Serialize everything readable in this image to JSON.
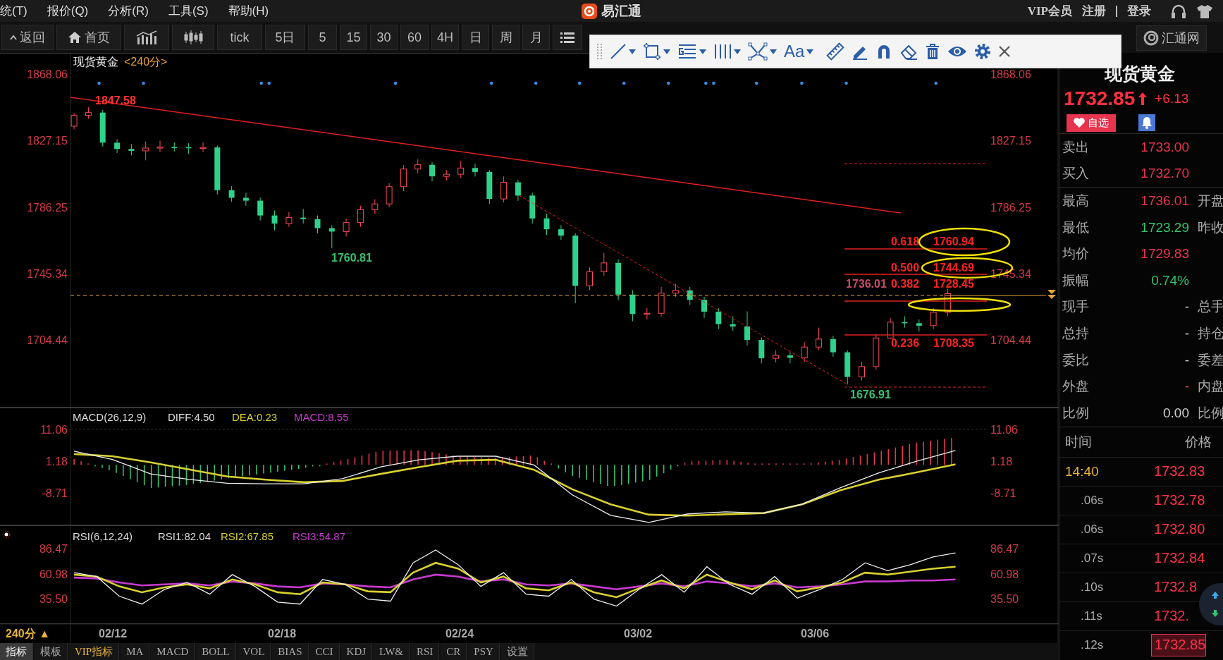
{
  "menu_bar": {
    "items": [
      "统(T)",
      "报价(Q)",
      "分析(R)",
      "工具(S)",
      "帮助(H)"
    ],
    "app_name": "易汇通",
    "vip": "VIP会员",
    "register": "注册",
    "login": "登录"
  },
  "toolbar": {
    "back": "返回",
    "home": "首页",
    "periods": [
      "tick",
      "5日",
      "5",
      "15",
      "30",
      "60",
      "4H",
      "日",
      "周",
      "月"
    ],
    "site": "汇通网"
  },
  "drawing_toolbar": {
    "text_tool": "Aa"
  },
  "price_chart": {
    "symbol": "现货黄金",
    "period": "<240分>",
    "right_labels": [
      "1868.06",
      "1827.15",
      "1786.25",
      "1745.34",
      "1704.44"
    ],
    "chart_data": {
      "type": "candlestick",
      "yticks": [
        {
          "value": 1868.06,
          "label": "1868.06"
        },
        {
          "value": 1827.15,
          "label": "1827.15"
        },
        {
          "value": 1786.25,
          "label": "1786.25"
        },
        {
          "value": 1745.34,
          "label": "1745.34"
        },
        {
          "value": 1704.44,
          "label": "1704.44"
        }
      ],
      "ylim": [
        1662.78,
        1881.08
      ],
      "categories": [
        null,
        null,
        null,
        null,
        null,
        null,
        null,
        null,
        null,
        null,
        null,
        null,
        null,
        null,
        null,
        null,
        null,
        null,
        null,
        null,
        null,
        null,
        null,
        null,
        null,
        null,
        null,
        null,
        null,
        null,
        null,
        null,
        null,
        null,
        null,
        null,
        null,
        null,
        null,
        null,
        null,
        null,
        null,
        null,
        null,
        null,
        null,
        null,
        null,
        null,
        null,
        null,
        null,
        null,
        null,
        null,
        null,
        null,
        null,
        null,
        null,
        null
      ],
      "ohlc": [
        [
          1836.0,
          1844.0,
          1834.0,
          1842.6
        ],
        [
          1842.6,
          1847.58,
          1840.5,
          1844.3
        ],
        [
          1844.3,
          1846.0,
          1823.5,
          1825.8
        ],
        [
          1825.8,
          1828.0,
          1819.5,
          1822.0
        ],
        [
          1822.0,
          1825.0,
          1818.0,
          1820.8
        ],
        [
          1820.8,
          1826.5,
          1815.0,
          1822.5
        ],
        [
          1822.5,
          1827.0,
          1820.0,
          1823.2
        ],
        [
          1823.2,
          1826.0,
          1820.5,
          1823.0
        ],
        [
          1823.0,
          1825.5,
          1819.0,
          1822.6
        ],
        [
          1822.6,
          1826.0,
          1820.0,
          1822.9
        ],
        [
          1822.9,
          1824.0,
          1794.0,
          1796.6
        ],
        [
          1796.6,
          1799.0,
          1789.5,
          1791.9
        ],
        [
          1791.9,
          1795.0,
          1787.0,
          1790.1
        ],
        [
          1790.1,
          1792.0,
          1778.0,
          1781.0
        ],
        [
          1781.0,
          1784.0,
          1772.0,
          1776.0
        ],
        [
          1776.0,
          1783.0,
          1774.0,
          1779.7
        ],
        [
          1779.7,
          1785.0,
          1776.0,
          1778.8
        ],
        [
          1778.8,
          1781.0,
          1770.0,
          1773.2
        ],
        [
          1773.2,
          1775.0,
          1760.81,
          1771.1
        ],
        [
          1771.1,
          1779.0,
          1768.0,
          1776.6
        ],
        [
          1776.6,
          1787.0,
          1774.0,
          1784.6
        ],
        [
          1784.6,
          1791.0,
          1782.0,
          1788.1
        ],
        [
          1788.1,
          1801.0,
          1786.0,
          1798.7
        ],
        [
          1798.7,
          1812.0,
          1796.0,
          1809.6
        ],
        [
          1809.6,
          1815.5,
          1807.0,
          1812.2
        ],
        [
          1812.2,
          1814.0,
          1802.0,
          1805.1
        ],
        [
          1805.1,
          1809.0,
          1802.5,
          1806.4
        ],
        [
          1806.4,
          1814.5,
          1804.0,
          1810.2
        ],
        [
          1810.2,
          1813.0,
          1805.0,
          1807.8
        ],
        [
          1807.8,
          1809.0,
          1788.0,
          1791.2
        ],
        [
          1791.2,
          1805.0,
          1789.0,
          1801.4
        ],
        [
          1801.4,
          1803.0,
          1790.0,
          1793.3
        ],
        [
          1793.3,
          1795.0,
          1776.0,
          1779.2
        ],
        [
          1779.2,
          1782.0,
          1769.0,
          1772.5
        ],
        [
          1772.5,
          1775.0,
          1766.0,
          1768.6
        ],
        [
          1768.6,
          1770.0,
          1727.0,
          1737.7
        ],
        [
          1737.7,
          1749.0,
          1735.0,
          1746.4
        ],
        [
          1746.4,
          1758.0,
          1744.0,
          1751.8
        ],
        [
          1751.8,
          1754.0,
          1729.0,
          1732.3
        ],
        [
          1732.3,
          1735.0,
          1716.0,
          1720.4
        ],
        [
          1720.4,
          1724.0,
          1717.0,
          1720.8
        ],
        [
          1720.8,
          1737.0,
          1719.0,
          1733.2
        ],
        [
          1733.2,
          1739.0,
          1731.0,
          1734.9
        ],
        [
          1734.9,
          1737.0,
          1726.0,
          1729.1
        ],
        [
          1729.1,
          1731.0,
          1718.0,
          1721.8
        ],
        [
          1721.8,
          1724.0,
          1711.0,
          1714.1
        ],
        [
          1714.1,
          1719.0,
          1710.0,
          1712.7
        ],
        [
          1712.7,
          1722.0,
          1701.0,
          1704.4
        ],
        [
          1704.4,
          1706.0,
          1690.0,
          1693.1
        ],
        [
          1693.1,
          1698.0,
          1690.5,
          1694.9
        ],
        [
          1694.9,
          1697.0,
          1690.0,
          1693.4
        ],
        [
          1693.4,
          1703.0,
          1691.0,
          1700.0
        ],
        [
          1700.0,
          1712.0,
          1698.0,
          1704.9
        ],
        [
          1704.9,
          1707.0,
          1694.0,
          1696.8
        ],
        [
          1696.8,
          1698.0,
          1676.91,
          1681.6
        ],
        [
          1681.6,
          1691.0,
          1679.5,
          1688.0
        ],
        [
          1688.0,
          1708.0,
          1686.0,
          1705.6
        ],
        [
          1705.6,
          1718.0,
          1705.0,
          1715.4
        ],
        [
          1715.4,
          1719.0,
          1712.0,
          1714.7
        ],
        [
          1714.7,
          1717.0,
          1709.5,
          1713.2
        ],
        [
          1713.2,
          1724.0,
          1711.0,
          1721.4
        ],
        [
          1721.4,
          1736.01,
          1719.0,
          1732.85
        ]
      ]
    },
    "annotations": [
      {
        "text": "1847.58",
        "color": "#ff3333"
      },
      {
        "text": "1760.81",
        "color": "#35c26f"
      },
      {
        "text": "1676.91",
        "color": "#35c26f"
      }
    ],
    "fib_levels": [
      {
        "ratio": "0.618",
        "value": "1760.94"
      },
      {
        "ratio": "0.500",
        "value": "1744.69"
      },
      {
        "ratio": "0.382",
        "value": "1728.45"
      },
      {
        "ratio": "0.236",
        "value": "1708.35"
      }
    ],
    "fib_note": "1736.01"
  },
  "macd": {
    "title": "MACD(26,12,9)",
    "diff": "DIFF:4.50",
    "dea": "DEA:0.23",
    "value": "MACD:8.55",
    "right_labels": [
      "11.06",
      "1.18",
      "-8.71"
    ],
    "chart_data": {
      "type": "line",
      "ylim": [
        -18.82,
        17.87
      ],
      "categories": [
        null,
        null,
        null,
        null,
        null,
        null,
        null,
        null,
        null,
        null,
        null,
        null,
        null,
        null,
        null,
        null,
        null,
        null,
        null,
        null,
        null,
        null,
        null,
        null
      ],
      "yticks": [
        {
          "value": 11.06,
          "label": "11.06"
        },
        {
          "value": 1.18,
          "label": "1.18"
        },
        {
          "value": -8.71,
          "label": "-8.71"
        }
      ],
      "series": [
        {
          "color": "#eeeeee",
          "values": [
            4.3,
            1.7,
            -2.8,
            -4.5,
            -5.7,
            -5.9,
            -5.9,
            -4.3,
            -0.6,
            1.6,
            2.7,
            2.7,
            0,
            -9.3,
            -15.7,
            -17.9,
            -15.3,
            -14.6,
            -15,
            -12.2,
            -7.1,
            -2.5,
            1.2,
            4.5
          ]
        },
        {
          "color": "#d8d030",
          "values": [
            3.4,
            2.7,
            0.8,
            -1.4,
            -3.6,
            -4.6,
            -5.4,
            -5,
            -2.8,
            -0.7,
            1.3,
            1.6,
            -1.5,
            -7.6,
            -12.3,
            -15.5,
            -15.8,
            -15.4,
            -15,
            -12.3,
            -7.9,
            -4.6,
            -2.3,
            0.2
          ]
        }
      ]
    }
  },
  "rsi": {
    "title": "RSI(6,12,24)",
    "rsi1": "RSI1:82.04",
    "rsi2": "RSI2:67.85",
    "rsi3": "RSI3:54.87",
    "right_labels": [
      "86.47",
      "60.98",
      "35.50"
    ],
    "chart_data": {
      "type": "line",
      "ylim": [
        9.66,
        110.16
      ],
      "categories": [
        null,
        null,
        null,
        null,
        null,
        null,
        null,
        null,
        null,
        null,
        null,
        null,
        null,
        null,
        null,
        null,
        null,
        null,
        null,
        null,
        null,
        null,
        null,
        null,
        null,
        null,
        null,
        null,
        null,
        null,
        null,
        null,
        null,
        null,
        null,
        null,
        null,
        null,
        null,
        null
      ],
      "yticks": [
        {
          "value": 86.47,
          "label": "86.47"
        },
        {
          "value": 60.98,
          "label": "60.98"
        },
        {
          "value": 35.5,
          "label": "35.50"
        }
      ],
      "series": [
        {
          "color": "#eeeeee",
          "values": [
            62,
            58,
            38,
            30,
            45,
            52,
            40,
            60,
            48,
            32,
            30,
            55,
            50,
            35,
            33,
            72,
            85,
            70,
            48,
            62,
            40,
            38,
            55,
            35,
            28,
            45,
            60,
            42,
            68,
            50,
            40,
            58,
            36,
            45,
            55,
            72,
            64,
            70,
            78,
            82
          ]
        },
        {
          "color": "#d8d030",
          "values": [
            60,
            58,
            48,
            42,
            47,
            50,
            46,
            55,
            50,
            42,
            40,
            52,
            50,
            43,
            42,
            62,
            72,
            66,
            52,
            58,
            46,
            44,
            52,
            42,
            37,
            46,
            54,
            46,
            60,
            52,
            45,
            54,
            43,
            47,
            52,
            62,
            60,
            63,
            66,
            68
          ]
        },
        {
          "color": "#c83ad0",
          "values": [
            57,
            56,
            52,
            49,
            50,
            51,
            49,
            53,
            51,
            48,
            47,
            51,
            50,
            48,
            47,
            55,
            60,
            58,
            53,
            55,
            50,
            49,
            51,
            48,
            45,
            48,
            51,
            48,
            53,
            51,
            48,
            51,
            47,
            48,
            50,
            53,
            53,
            54,
            54,
            55
          ]
        }
      ]
    }
  },
  "x_axis": {
    "period": "240分 ▲",
    "dates": [
      "02/12",
      "02/18",
      "02/24",
      "03/02",
      "03/06"
    ]
  },
  "indicator_tabs": [
    {
      "label": "指标",
      "selected": true
    },
    {
      "label": "模板",
      "selected": false
    },
    {
      "label": "VIP指标",
      "selected": false
    },
    {
      "label": "MA",
      "selected": false
    },
    {
      "label": "MACD",
      "selected": false
    },
    {
      "label": "BOLL",
      "selected": false
    },
    {
      "label": "VOL",
      "selected": false
    },
    {
      "label": "BIAS",
      "selected": false
    },
    {
      "label": "CCI",
      "selected": false
    },
    {
      "label": "KDJ",
      "selected": false
    },
    {
      "label": "LW&",
      "selected": false
    },
    {
      "label": "RSI",
      "selected": false
    },
    {
      "label": "CR",
      "selected": false
    },
    {
      "label": "PSY",
      "selected": false
    },
    {
      "label": "设置",
      "selected": false
    }
  ],
  "quote": {
    "name": "现货黄金",
    "price": "1732.85",
    "change": "+6.13",
    "favorite": "自选",
    "bid_ask": [
      {
        "label": "卖出",
        "value": "1733.00",
        "color": "#e8344e"
      },
      {
        "label": "买入",
        "value": "1732.70",
        "color": "#e8344e"
      }
    ],
    "stats": [
      {
        "label": "最高",
        "value": "1736.01",
        "color": "#e8344e",
        "extra": "开盘"
      },
      {
        "label": "最低",
        "value": "1723.29",
        "color": "#35c26f",
        "extra": "昨收"
      },
      {
        "label": "均价",
        "value": "1729.83",
        "color": "#e8344e"
      },
      {
        "label": "振幅",
        "value": "0.74%",
        "color": "#35c26f"
      },
      {
        "label": "现手",
        "value": "-",
        "color": "#cfcfcf",
        "extra": "总手"
      },
      {
        "label": "总持",
        "value": "-",
        "color": "#cfcfcf",
        "extra": "持仓"
      },
      {
        "label": "委比",
        "value": "-",
        "color": "#cfcfcf",
        "extra": "委差"
      },
      {
        "label": "外盘",
        "value": "-",
        "color": "#e8344e",
        "extra": "内盘"
      },
      {
        "label": "比例",
        "value": "0.00",
        "color": "#cfcfcf",
        "extra": "比例"
      }
    ],
    "ticks_header": [
      "时间",
      "价格"
    ],
    "ticks": [
      {
        "time": "14:40",
        "kind": "minute",
        "price": "1732.83",
        "selected": false
      },
      {
        "time": ".06s",
        "kind": "second",
        "price": "1732.78",
        "selected": false
      },
      {
        "time": ".06s",
        "kind": "second",
        "price": "1732.80",
        "selected": false
      },
      {
        "time": ".07s",
        "kind": "second",
        "price": "1732.84",
        "selected": false
      },
      {
        "time": ".10s",
        "kind": "second",
        "price": "1732.8",
        "selected": false
      },
      {
        "time": ".11s",
        "kind": "second",
        "price": "1732.",
        "selected": false
      },
      {
        "time": ".12s",
        "kind": "second",
        "price": "1732.85",
        "selected": true
      }
    ]
  }
}
